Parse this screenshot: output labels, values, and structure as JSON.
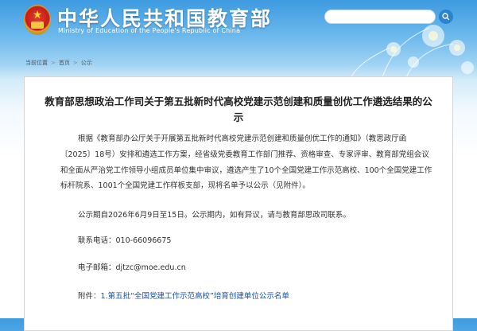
{
  "header": {
    "site_title": "中华人民共和国教育部",
    "site_subtitle": "Ministry of Education of the People's Republic of China",
    "search": {
      "placeholder": "",
      "value": ""
    }
  },
  "breadcrumb": {
    "items": [
      "当前位置",
      "首页",
      "公示"
    ],
    "separator": ">"
  },
  "article": {
    "title": "教育部思想政治工作司关于第五批新时代高校党建示范创建和质量创优工作遴选结果的公示",
    "paragraph1": "根据《教育部办公厅关于开展第五批新时代高校党建示范创建和质量创优工作的通知》（教思政厅函〔2025〕18号）安排和遴选工作方案，经省级党委教育工作部门推荐、资格审查、专家评审、教育部党组会议和全面从严治党工作领导小组成员单位集中审议，遴选产生了10个全国党建工作示范高校、100个全国党建工作标杆院系、1001个全国党建工作样板支部，现将名单予以公示（见附件）。",
    "paragraph2": "公示期自2026年6月9日至15日。公示期内，如有异议，请与教育部思政司联系。",
    "phone_label": "联系电话：",
    "phone": "010-66096675",
    "email_label": "电子邮箱：",
    "email": "djtzc@moe.edu.cn",
    "attachment_label": "附件：",
    "attachment_link": "1.第五批“全国党建工作示范高校”培育创建单位公示名单"
  },
  "colors": {
    "header_blue": "#3d9be0",
    "title_text": "#222222",
    "body_text": "#333333",
    "link": "#1b53a8"
  },
  "icons": [
    "national-emblem-icon",
    "search-icon"
  ]
}
